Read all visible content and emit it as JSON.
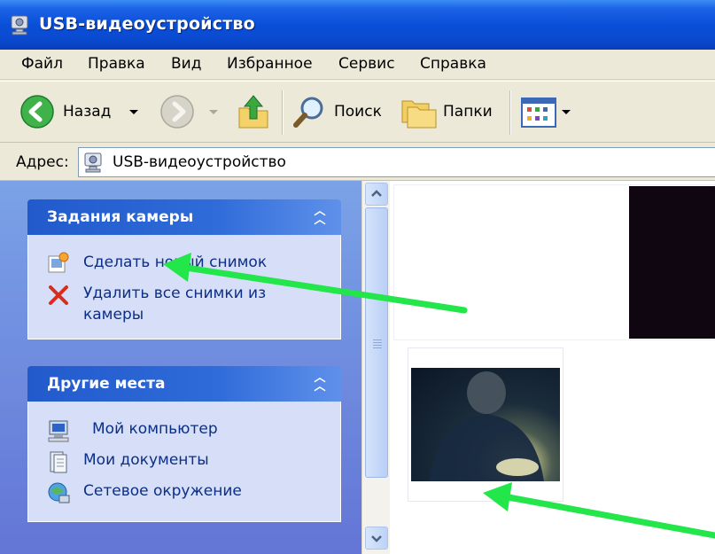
{
  "window": {
    "title": "USB-видеоустройство"
  },
  "menu": [
    "Файл",
    "Правка",
    "Вид",
    "Избранное",
    "Сервис",
    "Справка"
  ],
  "toolbar": {
    "back_label": "Назад",
    "search_label": "Поиск",
    "folders_label": "Папки"
  },
  "address": {
    "label": "Адрес:",
    "value": "USB-видеоустройство"
  },
  "camera_tasks": {
    "title": "Задания камеры",
    "items": [
      "Сделать новый снимок",
      "Удалить все снимки из",
      "камеры"
    ]
  },
  "other_places": {
    "title": "Другие места",
    "items": [
      "Мой компьютер",
      "Мои документы",
      "Сетевое окружение"
    ]
  },
  "colors": {
    "arrow": "#22e64a",
    "titlebar": "#0a4fd8",
    "taskpane": "#6f8fdf"
  }
}
